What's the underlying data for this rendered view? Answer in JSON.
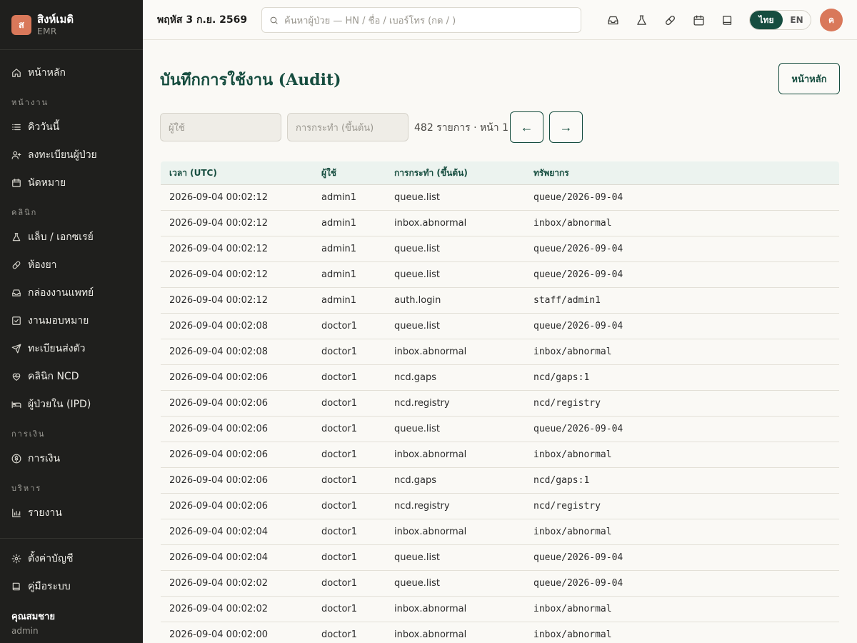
{
  "brand": {
    "logo_letter": "ส",
    "name": "สิงห์เมดิ",
    "sub": "EMR"
  },
  "nav": {
    "home": "หน้าหลัก",
    "section_work": "หน้างาน",
    "queue_today": "คิววันนี้",
    "register_patient": "ลงทะเบียนผู้ป่วย",
    "appointments": "นัดหมาย",
    "section_clinic": "คลินิก",
    "lab_xray": "แล็บ / เอกซเรย์",
    "pharmacy": "ห้องยา",
    "doctor_inbox": "กล่องงานแพทย์",
    "assignments": "งานมอบหมาย",
    "referrals": "ทะเบียนส่งตัว",
    "ncd_clinic": "คลินิก NCD",
    "ipd": "ผู้ป่วยใน (IPD)",
    "section_finance": "การเงิน",
    "billing": "การเงิน",
    "section_admin": "บริหาร",
    "reports": "รายงาน",
    "account_settings": "ตั้งค่าบัญชี",
    "manual": "คู่มือระบบ"
  },
  "user": {
    "name": "คุณสมชาย",
    "role": "admin",
    "avatar_letter": "ค"
  },
  "topbar": {
    "date": "พฤหัส 3 ก.ย. 2569",
    "search_placeholder": "ค้นหาผู้ป่วย — HN / ชื่อ / เบอร์โทร (กด / )",
    "lang_th": "ไทย",
    "lang_en": "EN",
    "icons": [
      "inbox-icon",
      "flask-icon",
      "pill-icon",
      "calendar-icon",
      "book-icon"
    ]
  },
  "page": {
    "title": "บันทึกการใช้งาน (Audit)",
    "home_button": "หน้าหลัก",
    "filter_user_placeholder": "ผู้ใช้",
    "filter_action_placeholder": "การกระทำ (ขึ้นต้น)",
    "count_text": "482 รายการ · หน้า 1",
    "prev": "←",
    "next": "→"
  },
  "table": {
    "headers": [
      "เวลา (UTC)",
      "ผู้ใช้",
      "การกระทำ (ขึ้นต้น)",
      "ทรัพยากร"
    ],
    "rows": [
      [
        "2026-09-04 00:02:12",
        "admin1",
        "queue.list",
        "queue/2026-09-04"
      ],
      [
        "2026-09-04 00:02:12",
        "admin1",
        "inbox.abnormal",
        "inbox/abnormal"
      ],
      [
        "2026-09-04 00:02:12",
        "admin1",
        "queue.list",
        "queue/2026-09-04"
      ],
      [
        "2026-09-04 00:02:12",
        "admin1",
        "queue.list",
        "queue/2026-09-04"
      ],
      [
        "2026-09-04 00:02:12",
        "admin1",
        "auth.login",
        "staff/admin1"
      ],
      [
        "2026-09-04 00:02:08",
        "doctor1",
        "queue.list",
        "queue/2026-09-04"
      ],
      [
        "2026-09-04 00:02:08",
        "doctor1",
        "inbox.abnormal",
        "inbox/abnormal"
      ],
      [
        "2026-09-04 00:02:06",
        "doctor1",
        "ncd.gaps",
        "ncd/gaps:1"
      ],
      [
        "2026-09-04 00:02:06",
        "doctor1",
        "ncd.registry",
        "ncd/registry"
      ],
      [
        "2026-09-04 00:02:06",
        "doctor1",
        "queue.list",
        "queue/2026-09-04"
      ],
      [
        "2026-09-04 00:02:06",
        "doctor1",
        "inbox.abnormal",
        "inbox/abnormal"
      ],
      [
        "2026-09-04 00:02:06",
        "doctor1",
        "ncd.gaps",
        "ncd/gaps:1"
      ],
      [
        "2026-09-04 00:02:06",
        "doctor1",
        "ncd.registry",
        "ncd/registry"
      ],
      [
        "2026-09-04 00:02:04",
        "doctor1",
        "inbox.abnormal",
        "inbox/abnormal"
      ],
      [
        "2026-09-04 00:02:04",
        "doctor1",
        "queue.list",
        "queue/2026-09-04"
      ],
      [
        "2026-09-04 00:02:02",
        "doctor1",
        "queue.list",
        "queue/2026-09-04"
      ],
      [
        "2026-09-04 00:02:02",
        "doctor1",
        "inbox.abnormal",
        "inbox/abnormal"
      ],
      [
        "2026-09-04 00:02:00",
        "doctor1",
        "inbox.abnormal",
        "inbox/abnormal"
      ]
    ]
  },
  "colors": {
    "primary": "#164d3f",
    "accent": "#d9785a",
    "sidebar_bg": "#1f1f1d",
    "page_bg": "#faf9f5",
    "table_header_bg": "#ecf3ef"
  }
}
